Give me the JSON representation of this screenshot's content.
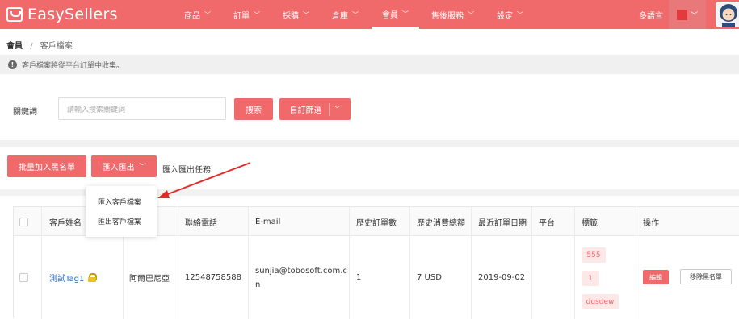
{
  "app": {
    "logo_text": "EasySellers"
  },
  "nav": [
    {
      "label": "商品"
    },
    {
      "label": "訂單"
    },
    {
      "label": "採購"
    },
    {
      "label": "倉庫"
    },
    {
      "label": "會員",
      "active": true
    },
    {
      "label": "售後服務"
    },
    {
      "label": "設定"
    }
  ],
  "header": {
    "language": "多語言"
  },
  "breadcrumb": {
    "root": "會員",
    "separator": "/",
    "current": "客戶檔案"
  },
  "notice": {
    "text": "客戶檔案將從平台訂單中收集。"
  },
  "search": {
    "label": "關鍵詞",
    "placeholder": "請輸入搜索關鍵詞",
    "search_button": "搜索",
    "custom_filter_button": "自訂篩選"
  },
  "toolbar": {
    "blacklist_button": "批量加入黑名單",
    "import_export_button": "匯入匯出",
    "tasks_link": "匯入匯出任務"
  },
  "dropdown": {
    "items": [
      "匯入客戶檔案",
      "匯出客戶檔案"
    ]
  },
  "table": {
    "headers": [
      "客戶姓名",
      "",
      "聯絡電話",
      "E-mail",
      "歷史訂單數",
      "歷史消費總額",
      "最近訂單日期",
      "平台",
      "標籤",
      "操作"
    ],
    "rows": [
      {
        "name": "測試Tag1",
        "country": "阿爾巴尼亞",
        "phone": "12548758588",
        "email_line1": "sunjia@tobosoft.com.c",
        "email_line2": "n",
        "orders": "1",
        "total": "7 USD",
        "last_order": "2019-09-02",
        "platform": "",
        "tags": [
          "555",
          "1",
          "dgsdew"
        ],
        "edit": "編輯",
        "remove": "移除黑名單"
      }
    ]
  },
  "colors": {
    "brand": "#f0696b",
    "accent_user": "#e23b3e",
    "link": "#2b6bb5"
  },
  "icons": {
    "logo": "shopping-bag-icon",
    "notice": "info-icon",
    "lock": "lock-icon",
    "chevron": "chevron-down-icon"
  }
}
